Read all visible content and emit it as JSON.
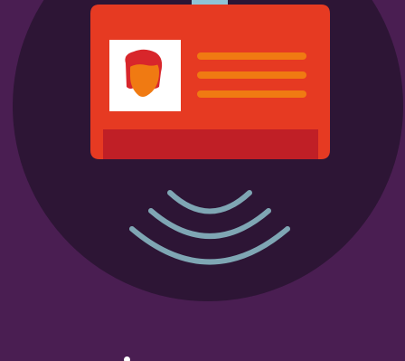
{
  "illustration": {
    "icon": "contactless-id-badge",
    "colors": {
      "background": "#4a1e52",
      "circle": "#2d1535",
      "badge": "#e63a22",
      "badge_footer": "#c01f26",
      "clip": "#8fc3d6",
      "photo_frame": "#ffffff",
      "hair": "#d8262b",
      "face": "#f07a12",
      "text_lines": "#f07a12",
      "waves": "#7fa6b4"
    },
    "text_line_count": 3,
    "wave_count": 3
  }
}
